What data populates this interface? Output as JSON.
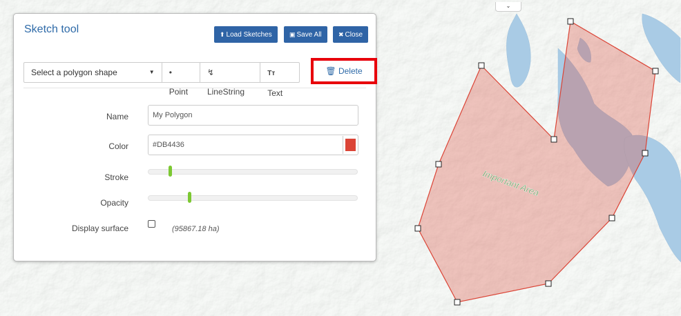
{
  "panel": {
    "title": "Sketch tool",
    "buttons": {
      "load": "Load Sketches",
      "save": "Save All",
      "close": "Close"
    },
    "shape_select": "Select a polygon shape",
    "tools": {
      "point": "• Point",
      "linestring": "LineString",
      "text_icon": "Tт",
      "text": "Text"
    },
    "delete": "Delete",
    "form": {
      "name_label": "Name",
      "name_value": "My Polygon",
      "color_label": "Color",
      "color_value": "#DB4436",
      "stroke_label": "Stroke",
      "stroke_level": 0.1,
      "opacity_label": "Opacity",
      "opacity_level": 0.2,
      "surface_label": "Display surface",
      "surface_checked": false,
      "surface_area": "(95867.18 ha)"
    }
  },
  "map": {
    "polygon_label": "Important Area",
    "polygon_fill": "#DB4436",
    "toggle_glyph": "⌄"
  }
}
